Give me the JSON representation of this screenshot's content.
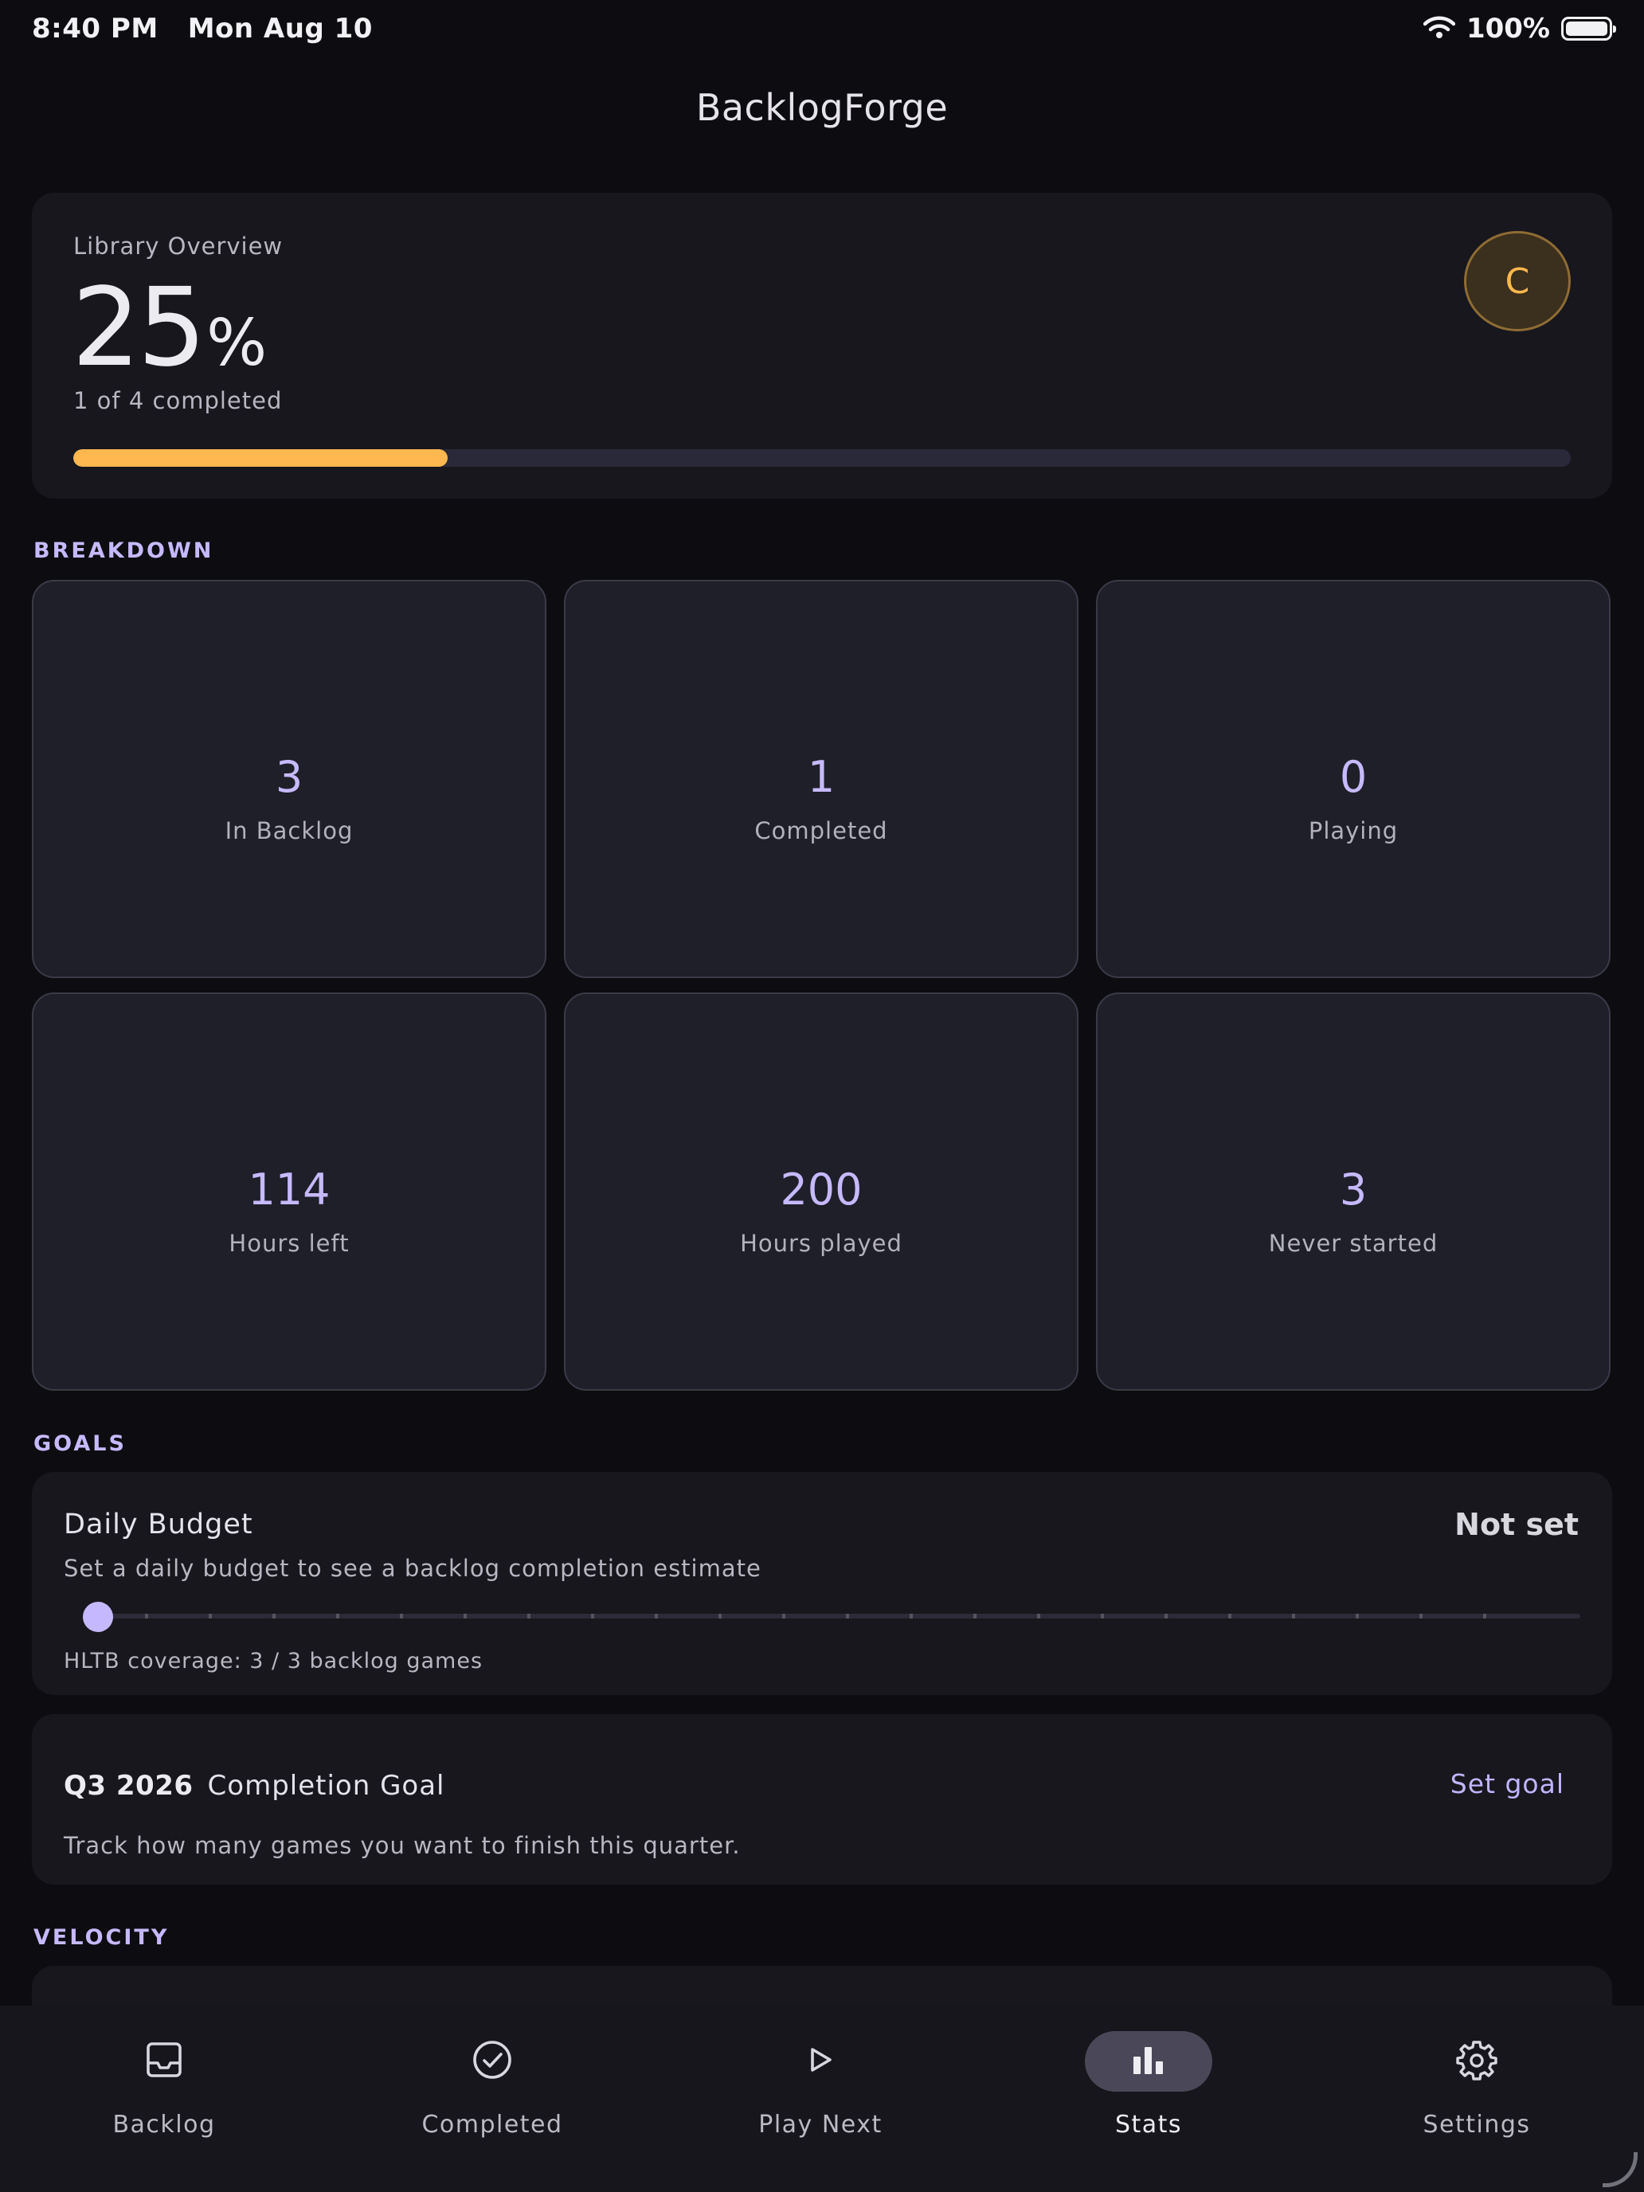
{
  "status_bar": {
    "time": "8:40 PM",
    "date": "Mon Aug 10",
    "battery": "100%",
    "icons": [
      "wifi-icon",
      "battery-icon"
    ]
  },
  "app": {
    "title": "BacklogForge"
  },
  "overview": {
    "label": "Library Overview",
    "percent": "25",
    "percent_sign": "%",
    "summary": "1 of 4 completed",
    "avatar_letter": "C",
    "progress_fraction": 0.25
  },
  "sections": {
    "breakdown": "BREAKDOWN",
    "goals": "GOALS",
    "velocity": "VELOCITY"
  },
  "breakdown": [
    {
      "value": "3",
      "label": "In Backlog"
    },
    {
      "value": "1",
      "label": "Completed"
    },
    {
      "value": "0",
      "label": "Playing"
    },
    {
      "value": "114",
      "label": "Hours left"
    },
    {
      "value": "200",
      "label": "Hours played"
    },
    {
      "value": "3",
      "label": "Never started"
    }
  ],
  "daily_budget": {
    "title": "Daily Budget",
    "value": "Not set",
    "description": "Set a daily budget to see a backlog completion estimate",
    "coverage": "HLTB coverage: 3 / 3 backlog games",
    "slider_value": 0
  },
  "quarter_goal": {
    "period": "Q3 2026",
    "title": "Completion Goal",
    "action": "Set goal",
    "description": "Track how many games you want to finish this quarter."
  },
  "nav": {
    "items": [
      {
        "label": "Backlog",
        "icon": "inbox-icon"
      },
      {
        "label": "Completed",
        "icon": "check-circle-icon"
      },
      {
        "label": "Play Next",
        "icon": "play-icon"
      },
      {
        "label": "Stats",
        "icon": "bar-chart-icon",
        "active": true
      },
      {
        "label": "Settings",
        "icon": "gear-icon"
      }
    ]
  },
  "colors": {
    "accent": "#c7b9ff",
    "progress": "#ffb74f",
    "background": "#0d0d11",
    "card": "#17171d"
  }
}
